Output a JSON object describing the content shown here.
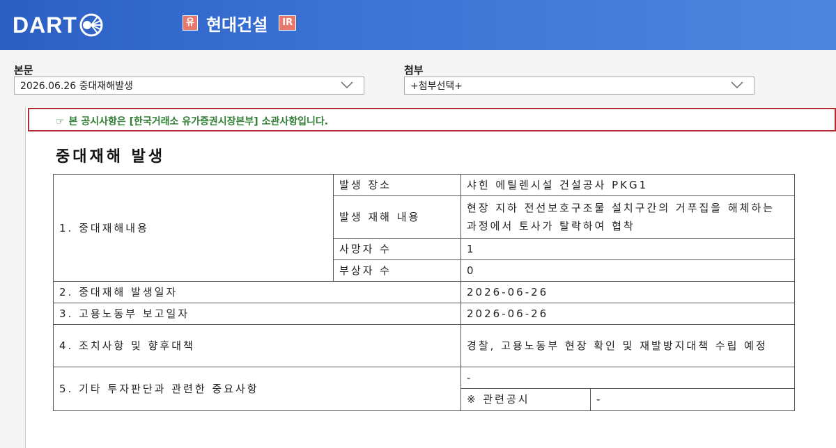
{
  "header": {
    "logo_text": "DART",
    "company_badge_left": "유",
    "company_name": "현대건설",
    "company_badge_right": "IR"
  },
  "controls": {
    "body_label": "본문",
    "body_select_value": "2026.06.26  중대재해발생",
    "attach_label": "첨부",
    "attach_select_value": "+첨부선택+"
  },
  "notice": {
    "icon": "☞",
    "text": "본 공시사항은 [한국거래소 유가증권시장본부] 소관사항입니다."
  },
  "document": {
    "title": "중대재해 발생",
    "section1_label": "1. 중대재해내용",
    "rows1": [
      {
        "label": "발생 장소",
        "value": "샤힌 에틸렌시설 건설공사 PKG1"
      },
      {
        "label": "발생 재해 내용",
        "value": "현장 지하 전선보호구조물 설치구간의 거푸집을 해체하는 과정에서 토사가 탈락하여 협착"
      },
      {
        "label": "사망자 수",
        "value": "1"
      },
      {
        "label": "부상자 수",
        "value": "0"
      }
    ],
    "row2": {
      "label": "2. 중대재해 발생일자",
      "value": "2026-06-26"
    },
    "row3": {
      "label": "3. 고용노동부 보고일자",
      "value": "2026-06-26"
    },
    "row4": {
      "label": "4. 조치사항 및 향후대책",
      "value": "경찰, 고용노동부 현장 확인 및 재발방지대책 수립 예정"
    },
    "row5": {
      "label": "5. 기타 투자판단과 관련한 중요사항",
      "value": "-",
      "sub_label": "※ 관련공시",
      "sub_value": "-"
    }
  },
  "colors": {
    "header_blue": "#3c74d6",
    "notice_border": "#b12a34",
    "notice_text": "#2e7d32",
    "badge": "#e8786c"
  }
}
